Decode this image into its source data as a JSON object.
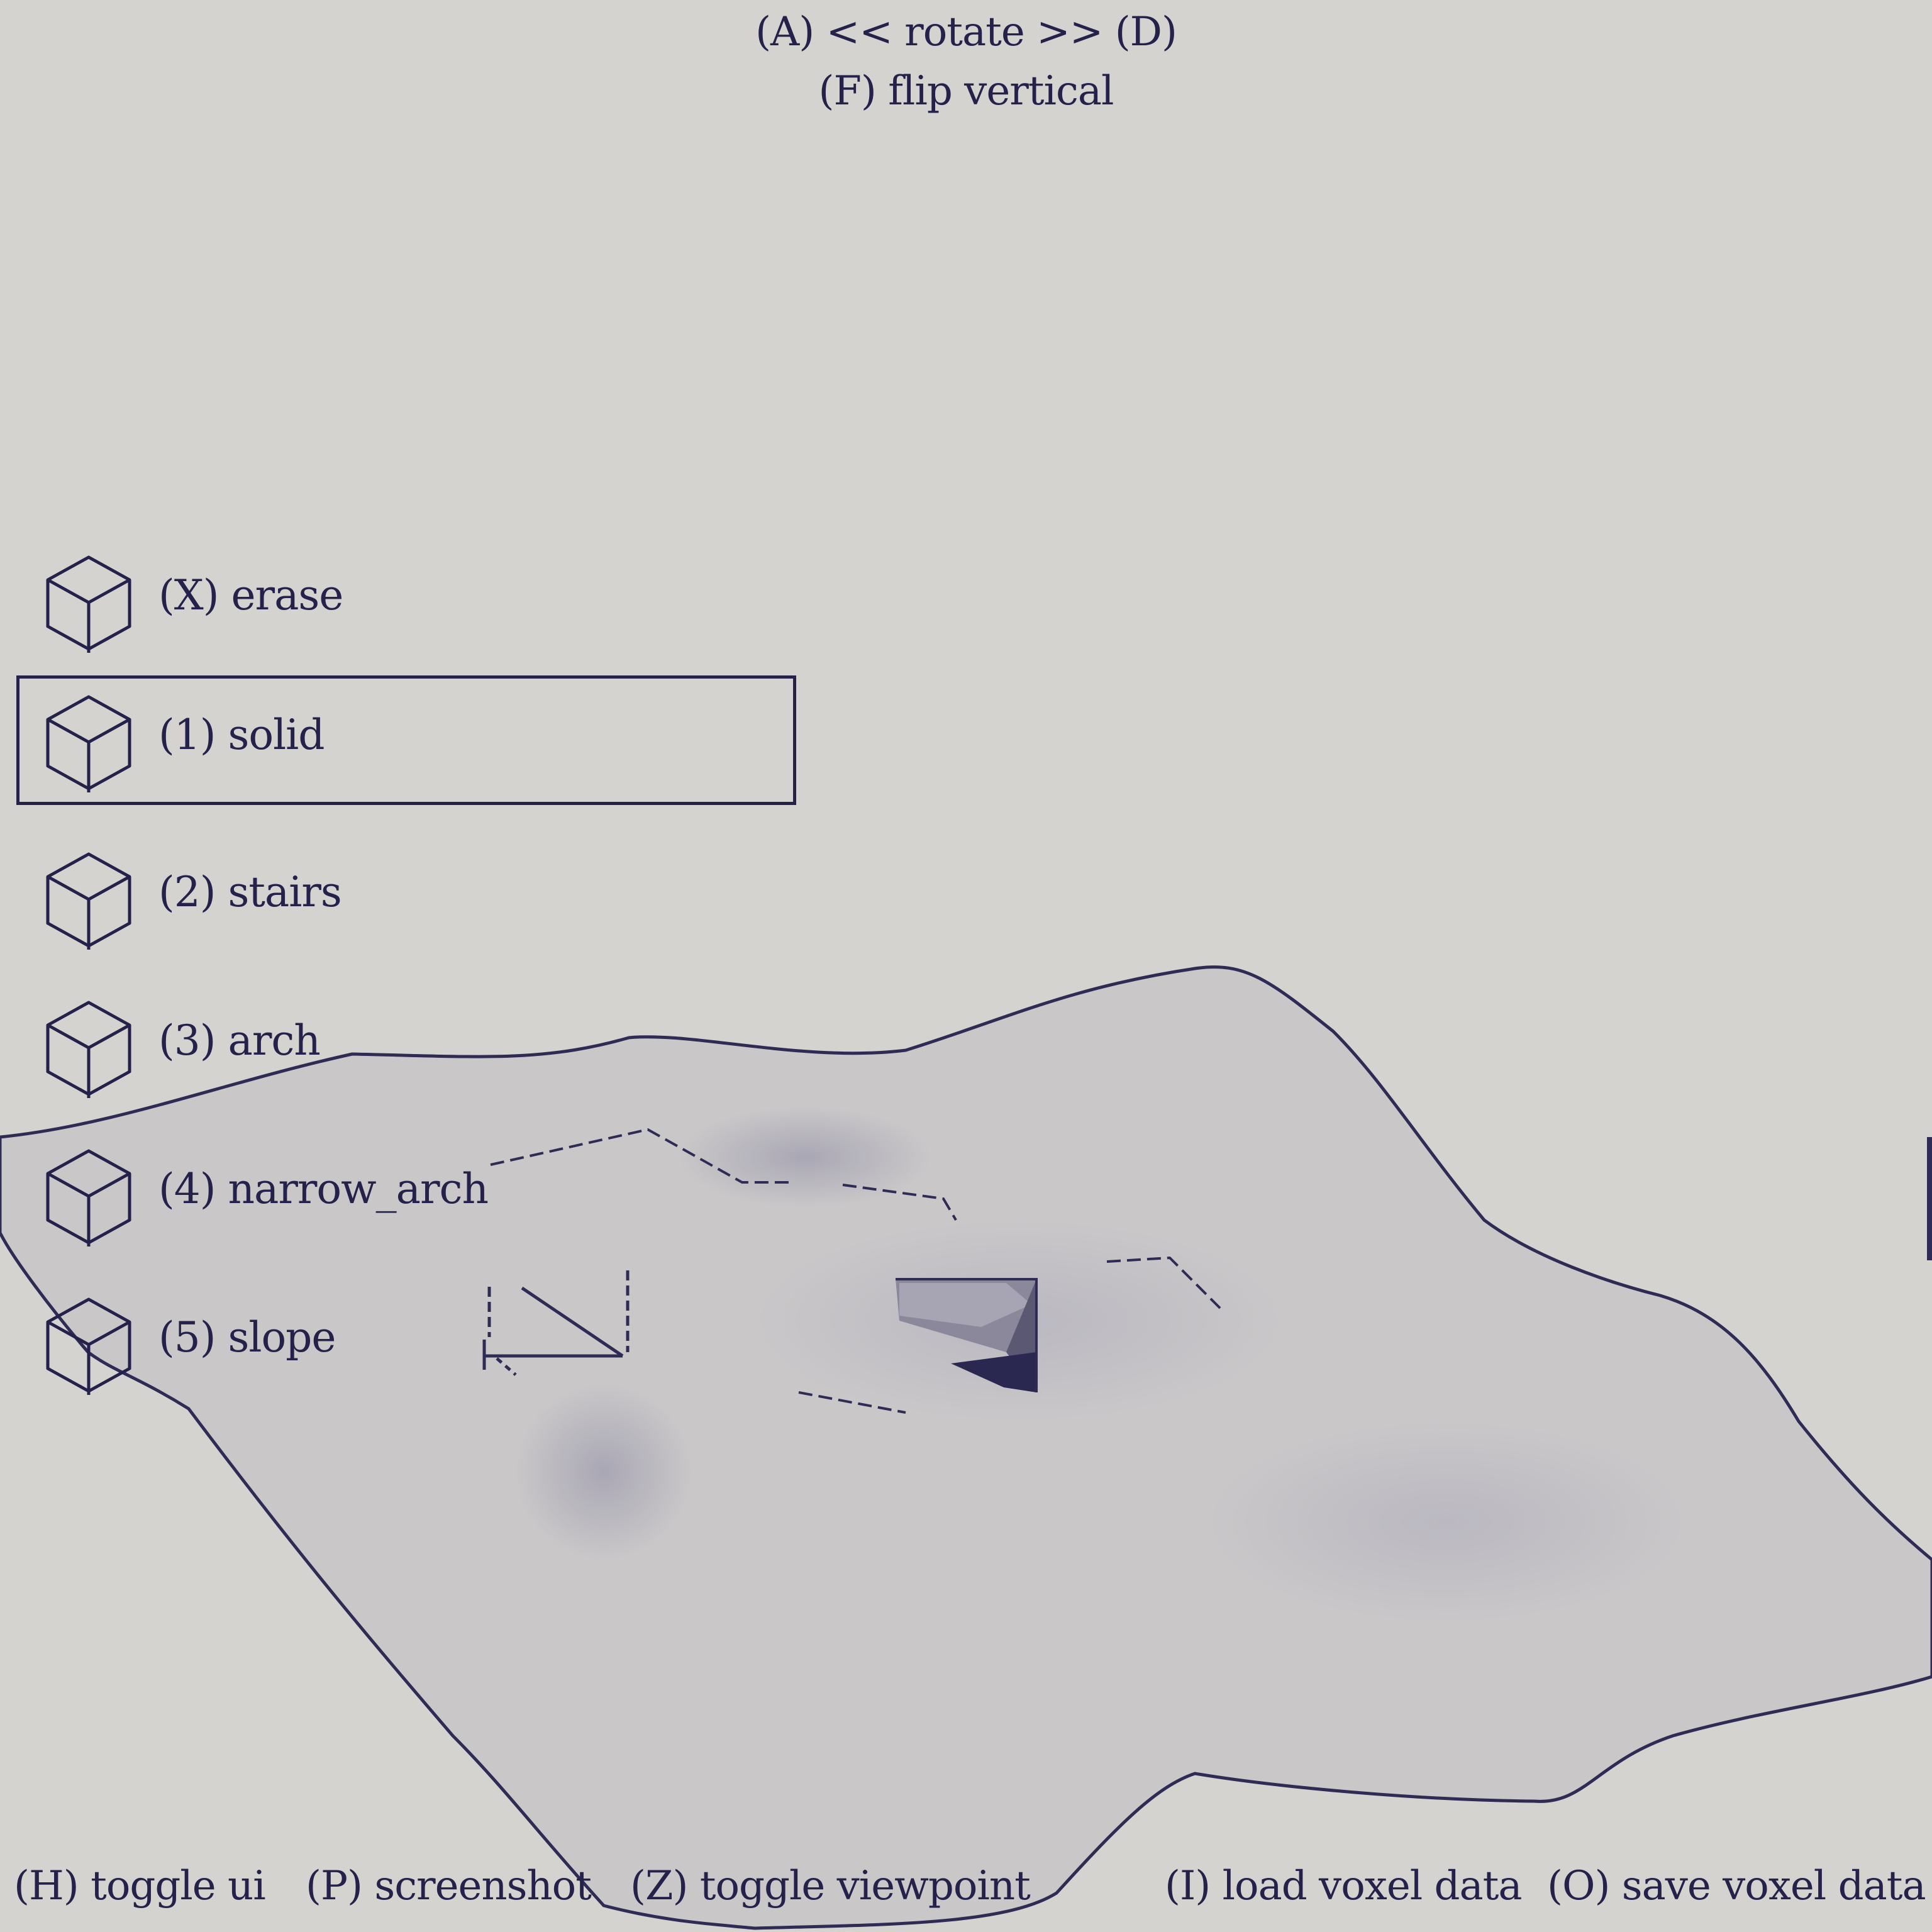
{
  "app": {
    "colors": {
      "background": "#d4d3cf",
      "ink": "#24224a",
      "terrain": "#c9c7c8",
      "terrain_shadow": "#a9a6b4"
    }
  },
  "header": {
    "rotate_hint": "(A) << rotate >> (D)",
    "flip_hint": "(F) flip vertical"
  },
  "toolbar": {
    "selected": "(1) solid",
    "tools": [
      {
        "key": "X",
        "label": "(X) erase",
        "icon": "cube-icon"
      },
      {
        "key": "1",
        "label": "(1) solid",
        "icon": "cube-icon"
      },
      {
        "key": "2",
        "label": "(2) stairs",
        "icon": "cube-icon"
      },
      {
        "key": "3",
        "label": "(3) arch",
        "icon": "cube-icon"
      },
      {
        "key": "4",
        "label": "(4) narrow_arch",
        "icon": "cube-icon"
      },
      {
        "key": "5",
        "label": "(5) slope",
        "icon": "cube-icon"
      }
    ]
  },
  "footer": {
    "toggle_ui": "(H) toggle ui",
    "screenshot": "(P) screenshot",
    "toggle_viewpoint": "(Z) toggle viewpoint",
    "load_voxel": "(I) load voxel data",
    "save_voxel": "(O) save voxel data"
  }
}
